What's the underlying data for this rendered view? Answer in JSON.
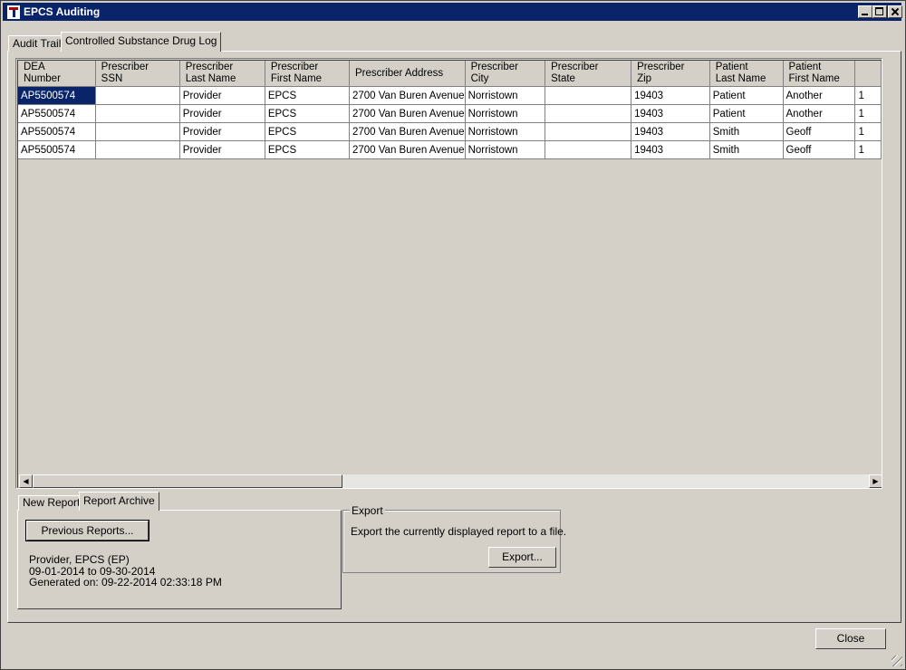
{
  "window": {
    "title": "EPCS Auditing"
  },
  "tabs": {
    "audit_trail": "Audit Trail",
    "drug_log": "Controlled Substance Drug Log"
  },
  "grid": {
    "columns": [
      {
        "label": "DEA\nNumber"
      },
      {
        "label": "Prescriber\nSSN"
      },
      {
        "label": "Prescriber\nLast Name"
      },
      {
        "label": "Prescriber\nFirst Name"
      },
      {
        "label": "Prescriber Address"
      },
      {
        "label": "Prescriber\nCity"
      },
      {
        "label": "Prescriber\nState"
      },
      {
        "label": "Prescriber\nZip"
      },
      {
        "label": "Patient\nLast Name"
      },
      {
        "label": "Patient\nFirst Name"
      },
      {
        "label": ""
      }
    ],
    "rows": [
      [
        "AP5500574",
        "",
        "Provider",
        "EPCS",
        "2700 Van Buren Avenue",
        "Norristown",
        "",
        "19403",
        "Patient",
        "Another",
        "1"
      ],
      [
        "AP5500574",
        "",
        "Provider",
        "EPCS",
        "2700 Van Buren Avenue",
        "Norristown",
        "",
        "19403",
        "Patient",
        "Another",
        "1"
      ],
      [
        "AP5500574",
        "",
        "Provider",
        "EPCS",
        "2700 Van Buren Avenue",
        "Norristown",
        "",
        "19403",
        "Smith",
        "Geoff",
        "1"
      ],
      [
        "AP5500574",
        "",
        "Provider",
        "EPCS",
        "2700 Van Buren Avenue",
        "Norristown",
        "",
        "19403",
        "Smith",
        "Geoff",
        "1"
      ]
    ]
  },
  "report_tabs": {
    "new_report": "New Report",
    "report_archive": "Report Archive"
  },
  "archive": {
    "previous_button": "Previous Reports...",
    "info_line1": "Provider,  EPCS  (EP)",
    "info_line2": "09-01-2014  to  09-30-2014",
    "info_line3": "Generated on: 09-22-2014 02:33:18 PM"
  },
  "export": {
    "legend": "Export",
    "description": "Export the currently displayed report to a file.",
    "button": "Export..."
  },
  "footer": {
    "close_button": "Close"
  },
  "scrollbar": {
    "left_arrow": "◀",
    "right_arrow": "▶"
  },
  "colors": {
    "titlebar": "#0a246a",
    "selection": "#0a246a",
    "face": "#d4d0c8"
  }
}
